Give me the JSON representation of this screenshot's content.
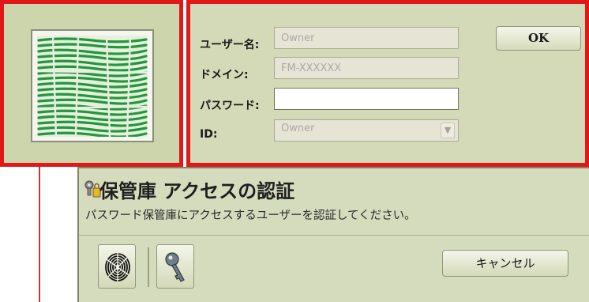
{
  "login": {
    "username_label": "ユーザー名:",
    "username_value": "Owner",
    "domain_label": "ドメイン:",
    "domain_value": "FM-XXXXXX",
    "password_label": "パスワード:",
    "password_value": "",
    "id_label": "ID:",
    "id_value": "Owner",
    "ok_label": "OK"
  },
  "dialog": {
    "title": "保管庫 アクセスの認証",
    "subtitle": "パスワード保管庫にアクセスするユーザーを認証してください。",
    "cancel_label": "キャンセル"
  },
  "icons": {
    "fingerprint_scan": "fingerprint-scan-icon",
    "vault_key": "vault-key-icon",
    "fingerprint_button": "fingerprint-icon",
    "key_button": "key-icon",
    "select_arrow": "chevron-down-icon"
  },
  "colors": {
    "highlight_border": "#e01818",
    "panel_bg": "#d4dab8",
    "fingerprint_green": "#1f9a3a"
  }
}
